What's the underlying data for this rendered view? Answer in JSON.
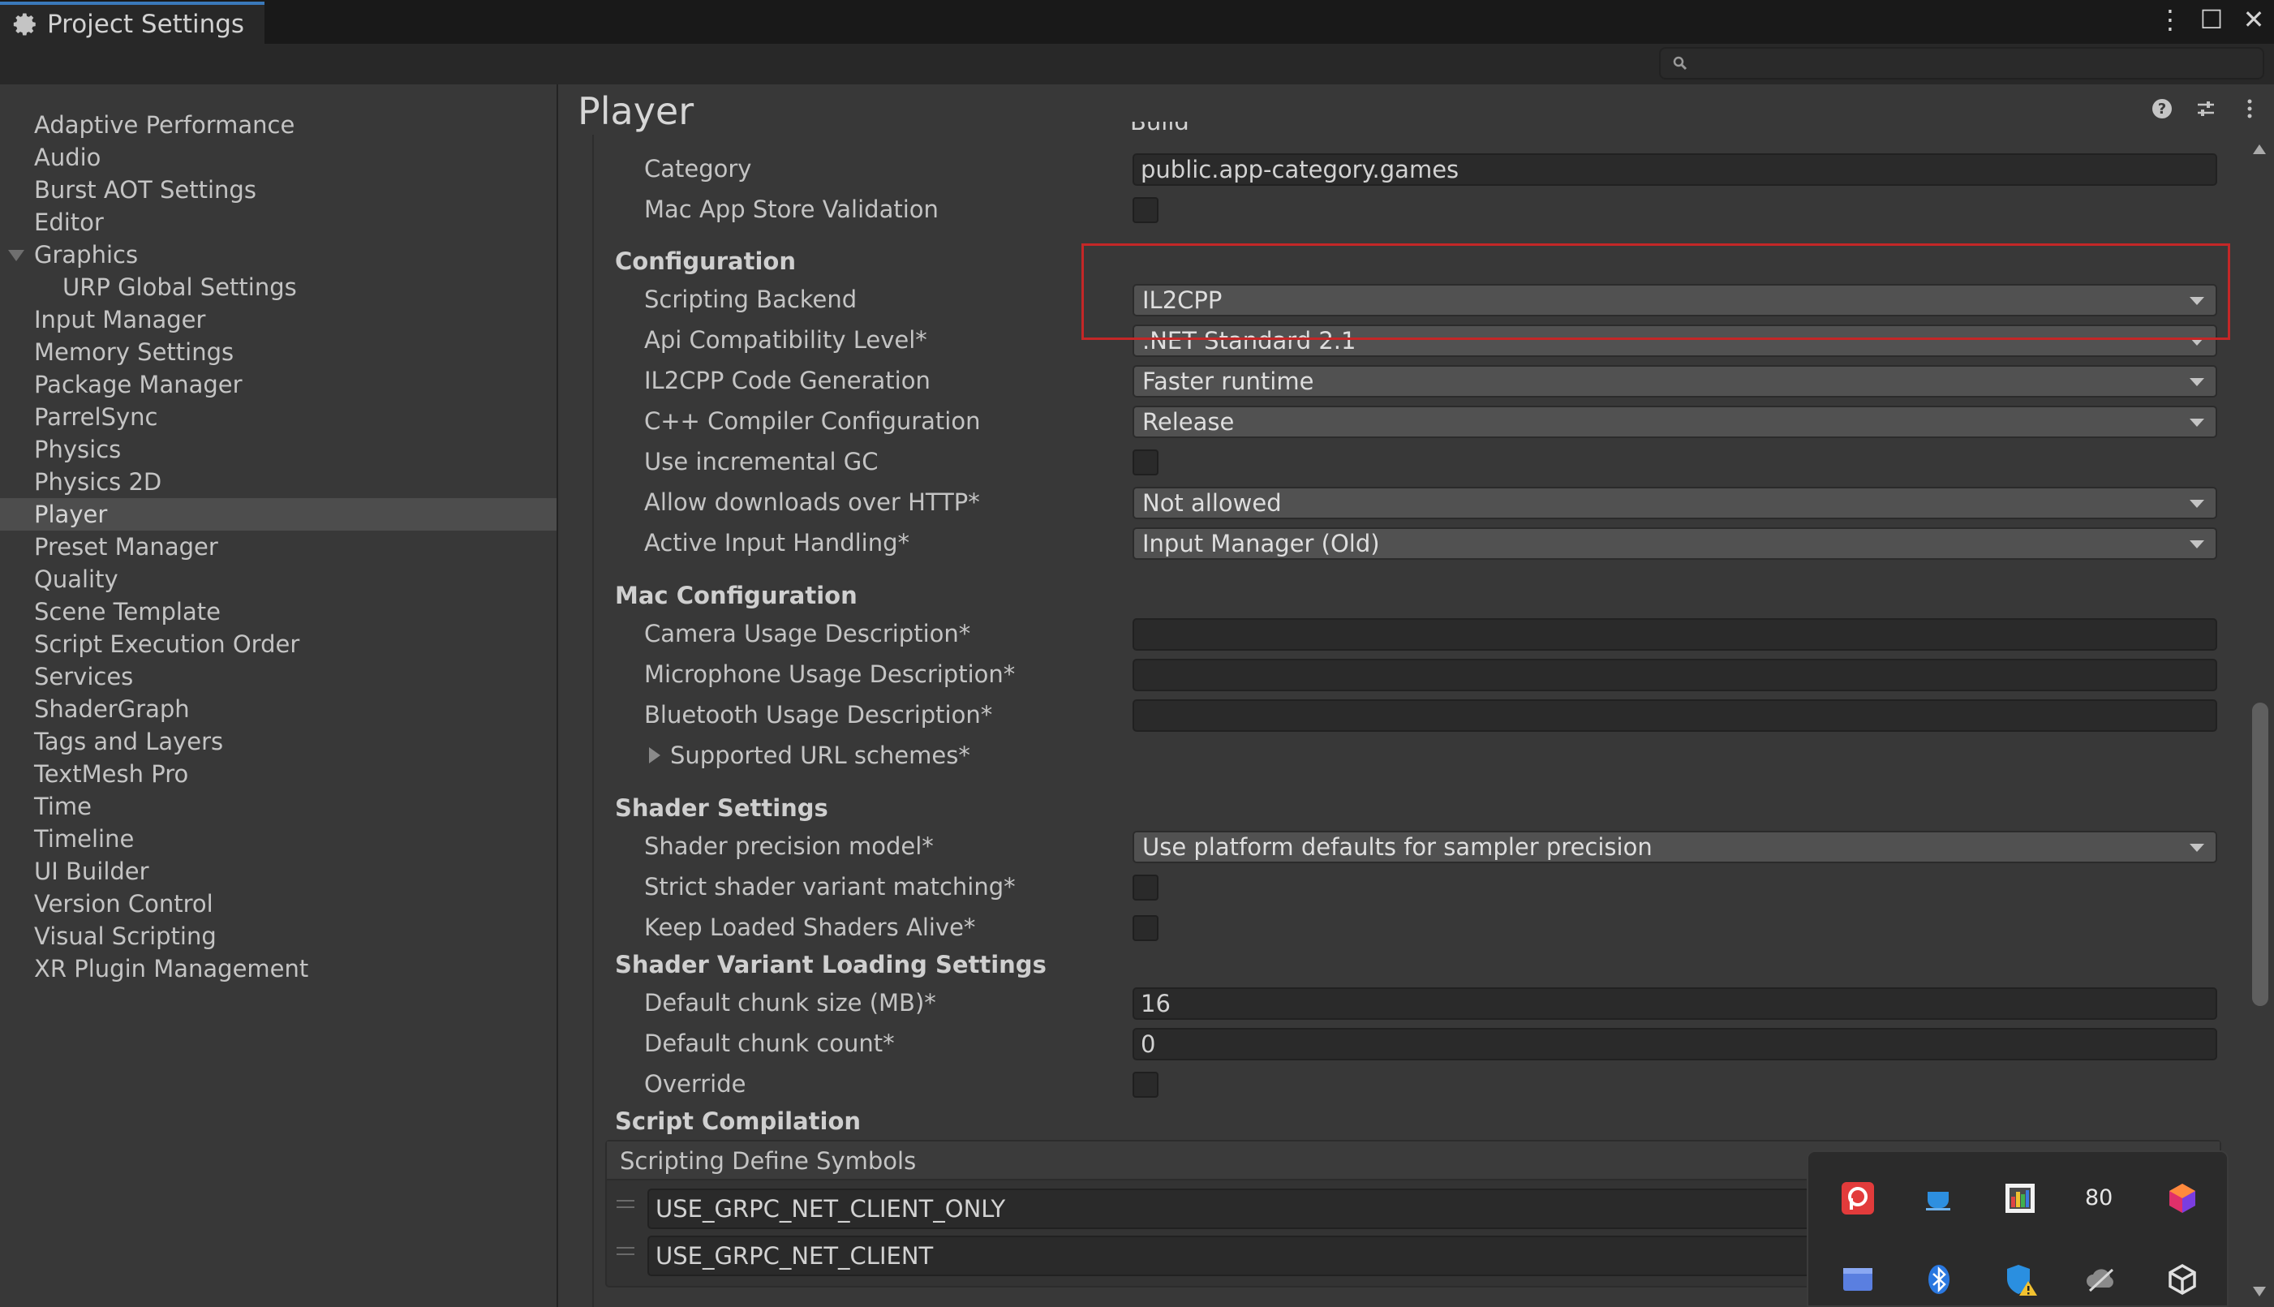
{
  "window": {
    "tab_title": "Project Settings"
  },
  "search": {
    "placeholder": ""
  },
  "sidebar": {
    "items": [
      {
        "label": "Adaptive Performance"
      },
      {
        "label": "Audio"
      },
      {
        "label": "Burst AOT Settings"
      },
      {
        "label": "Editor"
      },
      {
        "label": "Graphics"
      },
      {
        "label": "URP Global Settings"
      },
      {
        "label": "Input Manager"
      },
      {
        "label": "Memory Settings"
      },
      {
        "label": "Package Manager"
      },
      {
        "label": "ParrelSync"
      },
      {
        "label": "Physics"
      },
      {
        "label": "Physics 2D"
      },
      {
        "label": "Player"
      },
      {
        "label": "Preset Manager"
      },
      {
        "label": "Quality"
      },
      {
        "label": "Scene Template"
      },
      {
        "label": "Script Execution Order"
      },
      {
        "label": "Services"
      },
      {
        "label": "ShaderGraph"
      },
      {
        "label": "Tags and Layers"
      },
      {
        "label": "TextMesh Pro"
      },
      {
        "label": "Time"
      },
      {
        "label": "Timeline"
      },
      {
        "label": "UI Builder"
      },
      {
        "label": "Version Control"
      },
      {
        "label": "Visual Scripting"
      },
      {
        "label": "XR Plugin Management"
      }
    ],
    "selected": "Player"
  },
  "main": {
    "title": "Player",
    "clipped_label": "Build",
    "rows": {
      "category": {
        "label": "Category",
        "value": "public.app-category.games"
      },
      "mac_app_store_validation": {
        "label": "Mac App Store Validation"
      },
      "configuration_header": "Configuration",
      "scripting_backend": {
        "label": "Scripting Backend",
        "value": "IL2CPP"
      },
      "api_compat": {
        "label": "Api Compatibility Level*",
        "value": ".NET Standard 2.1"
      },
      "il2cpp_codegen": {
        "label": "IL2CPP Code Generation",
        "value": "Faster runtime"
      },
      "cpp_compiler": {
        "label": "C++ Compiler Configuration",
        "value": "Release"
      },
      "incremental_gc": {
        "label": "Use incremental GC"
      },
      "downloads_http": {
        "label": "Allow downloads over HTTP*",
        "value": "Not allowed"
      },
      "input_handling": {
        "label": "Active Input Handling*",
        "value": "Input Manager (Old)"
      },
      "mac_config_header": "Mac Configuration",
      "camera_usage": {
        "label": "Camera Usage Description*",
        "value": ""
      },
      "mic_usage": {
        "label": "Microphone Usage Description*",
        "value": ""
      },
      "bt_usage": {
        "label": "Bluetooth Usage Description*",
        "value": ""
      },
      "url_schemes": {
        "label": "Supported URL schemes*"
      },
      "shader_settings_header": "Shader Settings",
      "shader_precision": {
        "label": "Shader precision model*",
        "value": "Use platform defaults for sampler precision"
      },
      "strict_variant": {
        "label": "Strict shader variant matching*"
      },
      "keep_loaded": {
        "label": "Keep Loaded Shaders Alive*"
      },
      "variant_loading_header": "Shader Variant Loading Settings",
      "chunk_size": {
        "label": "Default chunk size (MB)*",
        "value": "16"
      },
      "chunk_count": {
        "label": "Default chunk count*",
        "value": "0"
      },
      "override": {
        "label": "Override"
      },
      "script_compilation_header": "Script Compilation"
    },
    "defines": {
      "header": "Scripting Define Symbols",
      "items": [
        "USE_GRPC_NET_CLIENT_ONLY",
        "USE_GRPC_NET_CLIENT"
      ]
    }
  },
  "tray": {
    "count_label": "80"
  },
  "colors": {
    "highlight_box": "#c42727",
    "tab_accent": "#3a79bb"
  }
}
